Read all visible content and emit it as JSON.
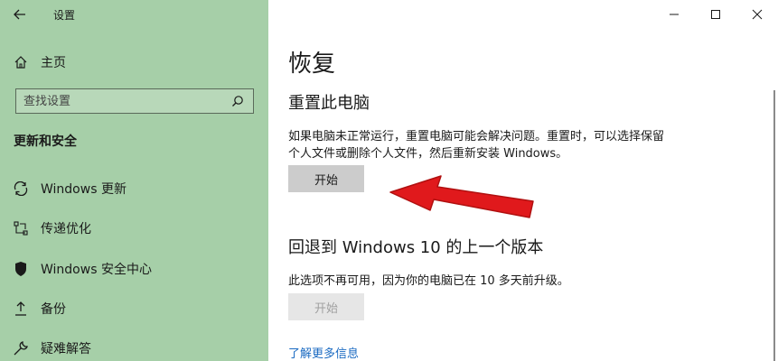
{
  "window": {
    "app_title": "设置"
  },
  "sidebar": {
    "home_label": "主页",
    "search_placeholder": "查找设置",
    "section_title": "更新和安全",
    "items": [
      {
        "label": "Windows 更新",
        "icon": "sync-icon"
      },
      {
        "label": "传递优化",
        "icon": "delivery-optimization-icon"
      },
      {
        "label": "Windows 安全中心",
        "icon": "shield-icon"
      },
      {
        "label": "备份",
        "icon": "backup-icon"
      },
      {
        "label": "疑难解答",
        "icon": "wrench-icon"
      }
    ]
  },
  "main": {
    "page_title": "恢复",
    "reset": {
      "heading": "重置此电脑",
      "description_line1": "如果电脑未正常运行，重置电脑可能会解决问题。重置时，可以选择保留",
      "description_line2": "个人文件或删除个人文件，然后重新安装 Windows。",
      "button_label": "开始"
    },
    "rollback": {
      "heading": "回退到 Windows 10 的上一个版本",
      "description": "此选项不再可用，因为你的电脑已在 10 多天前升级。",
      "button_label": "开始"
    },
    "learn_more_link": "了解更多信息"
  },
  "colors": {
    "sidebar_bg": "#a6cfa8",
    "link": "#1a6ac2",
    "arrow": "#e0191c"
  }
}
